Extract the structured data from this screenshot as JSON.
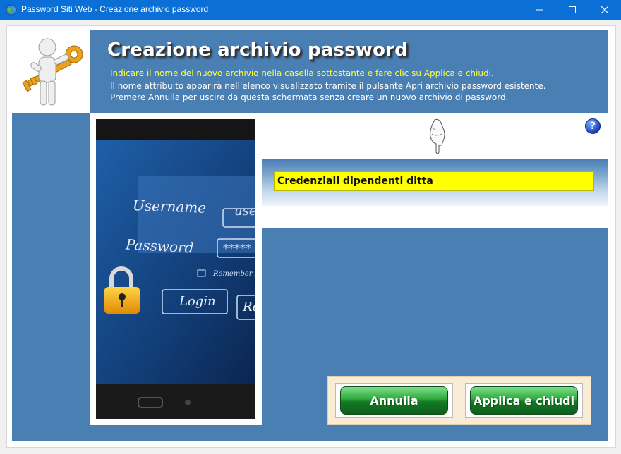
{
  "window": {
    "title": "Password Siti Web - Creazione archivio password",
    "icon": "globe-icon",
    "controls": [
      "minimize-icon",
      "maximize-icon",
      "close-icon"
    ]
  },
  "header": {
    "title": "Creazione archivio password",
    "line1": "Indicare il nome del nuovo archivio nella casella sottostante e fare clic su Applica e chiudi.",
    "line2": "Il nome attribuito apparirà nell'elenco visualizzato tramite il pulsante Apri archivio password esistente.",
    "line3": "Premere Annulla per uscire da questa schermata senza creare un nuovo archivio di password.",
    "logo_icon": "person-with-key-icon"
  },
  "photo": {
    "username_label": "Username",
    "password_label": "Password",
    "username_field": "use",
    "password_field": "*****",
    "remember_label": "Remember M",
    "login_button": "Login",
    "reset_button": "Re",
    "lock_icon": "padlock-icon"
  },
  "form": {
    "archive_name": "Credenziali dipendenti ditta",
    "pointer_icon": "pointing-hand-icon",
    "help_label": "?"
  },
  "buttons": {
    "cancel": "Annulla",
    "apply": "Applica e chiudi"
  },
  "colors": {
    "titlebar": "#0a6fd6",
    "panel_blue": "#4a7fb4",
    "input_yellow": "#ffff00",
    "header_highlight": "#ffff40",
    "button_green": "#2fa83e"
  }
}
